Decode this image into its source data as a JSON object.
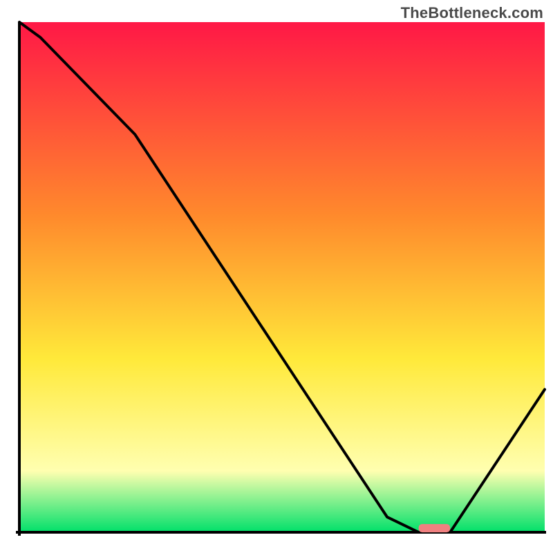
{
  "watermark": "TheBottleneck.com",
  "colors": {
    "gradient_top": "#ff1846",
    "gradient_upper_mid": "#ff8a2c",
    "gradient_yellow": "#ffe93a",
    "gradient_pale": "#ffffb0",
    "gradient_bottom": "#00e06a",
    "curve": "#000000",
    "marker_fill": "#f08080",
    "axis": "#000000"
  },
  "chart_data": {
    "type": "line",
    "title": "",
    "xlabel": "",
    "ylabel": "",
    "xlim": [
      0,
      100
    ],
    "ylim": [
      0,
      100
    ],
    "grid": false,
    "legend": false,
    "x": [
      0,
      4,
      22,
      70,
      76,
      82,
      100
    ],
    "y": [
      100,
      97,
      78,
      3,
      0,
      0,
      28
    ],
    "optimal_marker": {
      "x_start": 76,
      "x_end": 82,
      "y": 0.8
    },
    "notes": "Axes carry no tick labels or titles in the source image; values are normalized 0–100 to the plotting rectangle. The curve starts at the top-left, slopes down (with a visible kink near x≈22), reaches the x-axis near x≈76–82, and rises again toward the right edge."
  }
}
